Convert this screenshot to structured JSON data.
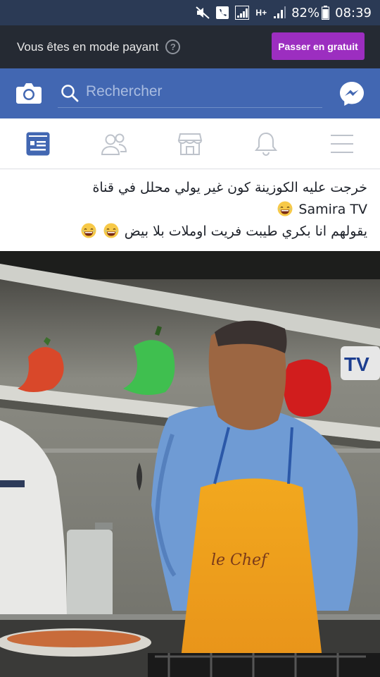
{
  "status_bar": {
    "battery": "82%",
    "time": "08:39",
    "network": "H+",
    "icons": [
      "mute-icon",
      "call-icon",
      "signal-icon",
      "network-type-icon",
      "signal-bars-icon",
      "battery-icon"
    ]
  },
  "paying_banner": {
    "text": "Vous êtes en mode payant",
    "help_symbol": "?",
    "button_label": "Passer en gratuit",
    "button_color": "#9c2ec0"
  },
  "header": {
    "search_placeholder": "Rechercher",
    "background": "#4267b2",
    "icons": [
      "camera-icon",
      "search-icon",
      "messenger-icon"
    ]
  },
  "nav_tabs": [
    {
      "name": "news-feed",
      "icon": "news-feed-icon",
      "active": true
    },
    {
      "name": "friends",
      "icon": "friends-icon",
      "active": false
    },
    {
      "name": "marketplace",
      "icon": "marketplace-icon",
      "active": false
    },
    {
      "name": "notifications",
      "icon": "bell-icon",
      "active": false
    },
    {
      "name": "menu",
      "icon": "menu-icon",
      "active": false
    }
  ],
  "post": {
    "line1": "خرجت عليه الكوزينة كون غير يولي محلل في قناة",
    "line2": "Samira TV",
    "line3": "يقولهم انا بكري طيبت فريت اوملات بلا بيض",
    "emoji": "laughing-emoji"
  },
  "photo": {
    "description_icons": [
      "tv-logo"
    ],
    "apron_logo": "le Chef",
    "channel_logo": "TV"
  }
}
